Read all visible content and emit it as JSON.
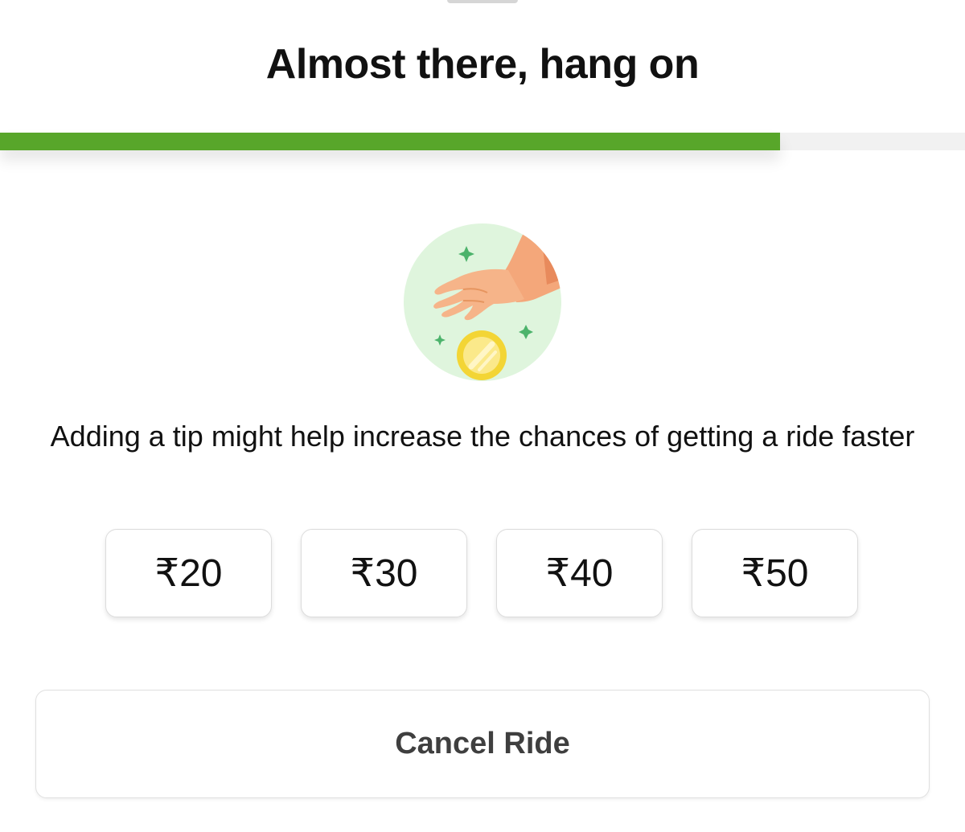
{
  "header": {
    "title": "Almost there, hang on"
  },
  "progress": {
    "value": 0.808,
    "fill_color": "#58a62a",
    "track_color": "#f1f1f1"
  },
  "illustration": {
    "icon": "hand-dropping-coin-icon",
    "background_color": "#dff5dd",
    "coin_color": "#f3d535",
    "sparkle_color": "#4cb36b"
  },
  "message": {
    "text": "Adding a tip might help increase the chances of getting a ride faster"
  },
  "tips": {
    "options": [
      {
        "label": "₹20"
      },
      {
        "label": "₹30"
      },
      {
        "label": "₹40"
      },
      {
        "label": "₹50"
      }
    ]
  },
  "actions": {
    "cancel_label": "Cancel Ride"
  }
}
